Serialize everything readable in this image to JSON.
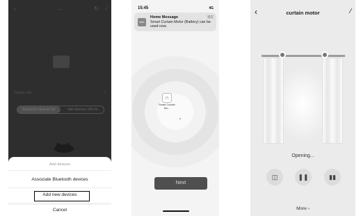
{
  "panel1": {
    "topbar": {
      "back_icon": "chevron-left",
      "title": "···",
      "icons": [
        "refresh-icon",
        "edit-icon"
      ]
    },
    "device_row_label": "Curtain info",
    "segments": [
      "Bluetooth devices list",
      "Add devices (Wi-Fi)"
    ],
    "sheet": {
      "title": "Add devices",
      "options": [
        "Associate Bluetooth devices",
        "Add new devices"
      ],
      "cancel": "Cancel"
    }
  },
  "panel2": {
    "status_time": "15:45",
    "status_signal": "4G",
    "notification": {
      "app_icon_text": "tedo",
      "title": "Home Message",
      "body": "Smart Curtain Motor (Battery) can be used now.",
      "meta": "现在"
    },
    "device": {
      "name": "Smart Curtain Mo..."
    },
    "next_label": "Next"
  },
  "panel3": {
    "title": "curtain motor",
    "back_icon": "chevron-left",
    "edit_icon": "edit-icon",
    "status": "Opening...",
    "controls": [
      "open-icon",
      "pause-icon",
      "close-icon"
    ],
    "more_label": "More ›"
  }
}
